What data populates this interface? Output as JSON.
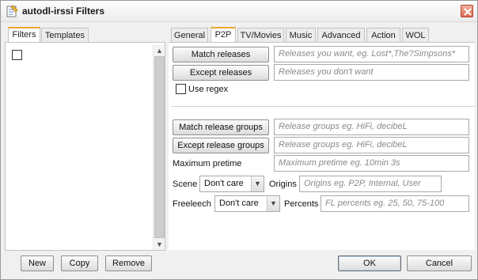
{
  "window": {
    "title": "autodl-irssi Filters",
    "app_icon": "notepad-icon",
    "close_icon": "close-icon"
  },
  "left_tabs": [
    {
      "label": "Filters",
      "active": true
    },
    {
      "label": "Templates",
      "active": false
    }
  ],
  "filter_list": {
    "items": [
      {
        "checked": false,
        "label": ""
      }
    ]
  },
  "left_buttons": {
    "new": "New",
    "copy": "Copy",
    "remove": "Remove"
  },
  "right_tabs": [
    {
      "label": "General",
      "active": false
    },
    {
      "label": "P2P",
      "active": true
    },
    {
      "label": "TV/Movies",
      "active": false
    },
    {
      "label": "Music",
      "active": false
    },
    {
      "label": "Advanced",
      "active": false
    },
    {
      "label": "Action",
      "active": false
    },
    {
      "label": "WOL",
      "active": false
    }
  ],
  "p2p": {
    "match_releases_button": "Match releases",
    "match_releases_placeholder": "Releases you want, eg. Lost*,The?Simpsons*",
    "except_releases_button": "Except releases",
    "except_releases_placeholder": "Releases you don't want",
    "use_regex_label": "Use regex",
    "use_regex_checked": false,
    "match_groups_button": "Match release groups",
    "match_groups_placeholder": "Release groups eg. HiFi, decibeL",
    "except_groups_button": "Except release groups",
    "except_groups_placeholder": "Release groups eg. HiFi, decibeL",
    "max_pretime_label": "Maximum pretime",
    "max_pretime_placeholder": "Maximum pretime eg. 10min 3s",
    "scene_label": "Scene",
    "scene_value": "Don't care",
    "origins_label": "Origins",
    "origins_placeholder": "Origins eg. P2P, Internal, User",
    "freeleech_label": "Freeleech",
    "freeleech_value": "Don't care",
    "percents_label": "Percents",
    "percents_placeholder": "FL percents eg. 25, 50, 75-100"
  },
  "dialog_buttons": {
    "ok": "OK",
    "cancel": "Cancel"
  },
  "colors": {
    "active_tab_accent": "#e6a82e",
    "close_button": "#d96b52"
  }
}
